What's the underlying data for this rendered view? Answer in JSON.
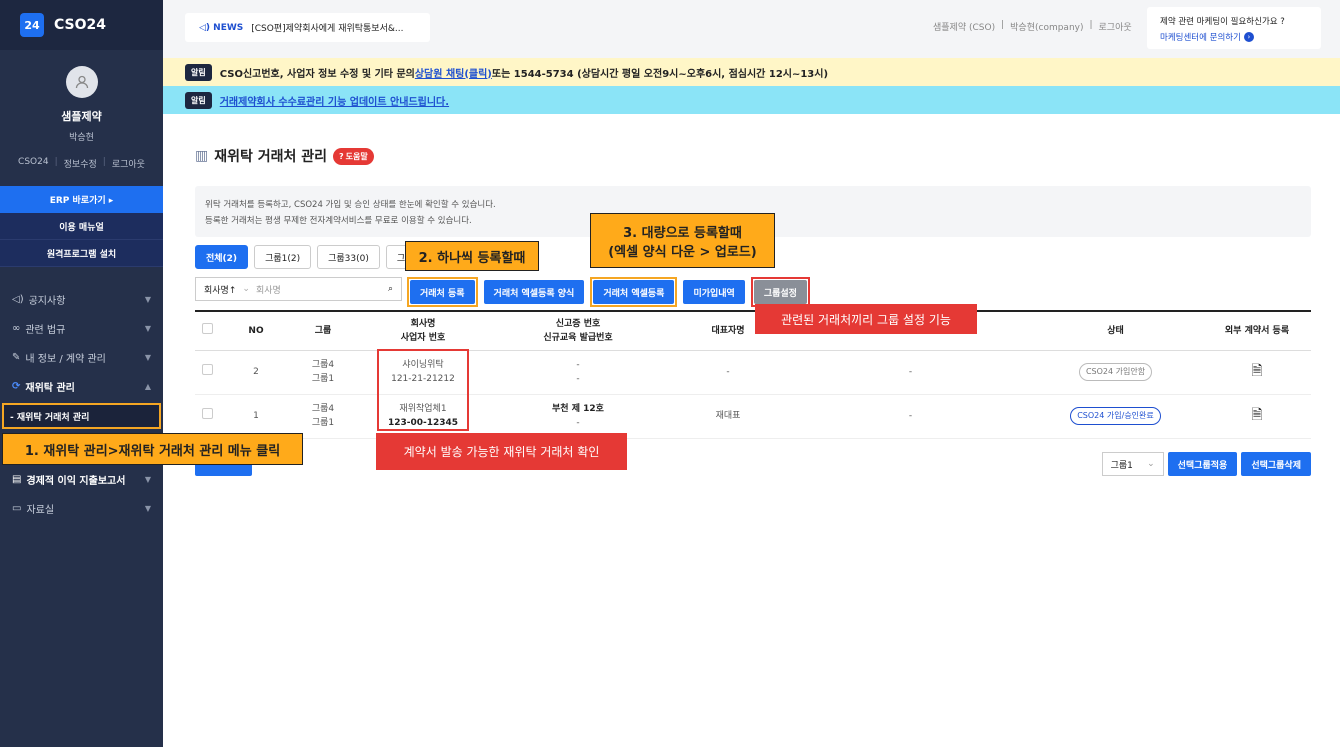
{
  "app": {
    "badge": "24",
    "name": "CSO24"
  },
  "profile": {
    "company": "샘플제약",
    "user": "박승현",
    "links": [
      "CSO24",
      "정보수정",
      "로그아웃"
    ]
  },
  "sidebar": {
    "erp": "ERP 바로가기 ▸",
    "manual": "이용 매뉴얼",
    "remote": "원격프로그램 설치",
    "items": [
      {
        "label": "공지사항",
        "icon": "speaker-icon"
      },
      {
        "label": "관련 법규",
        "icon": "link-icon"
      },
      {
        "label": "내 정보 / 계약 관리",
        "icon": "pen-icon"
      },
      {
        "label": "재위탁 관리",
        "icon": "refresh-icon"
      },
      {
        "label": "경제적 이익 지출보고서",
        "icon": "document-icon"
      },
      {
        "label": "자료실",
        "icon": "archive-icon"
      }
    ],
    "sub_item": "- 재위탁 거래처 관리"
  },
  "topbar": {
    "news_tag": "NEWS",
    "news_text": "[CSO편]제약회사에게 재위탁통보서&...",
    "links": [
      "샘플제약 (CSO)",
      "박승현(company)",
      "로그아웃"
    ],
    "ad_line1": "제약 관련 마케팅이 필요하신가요 ?",
    "ad_line2": "마케팅센터에 문의하기"
  },
  "notices": {
    "tag": "알림",
    "n1_pre": "CSO신고번호, 사업자 정보 수정 및 기타 문의 ",
    "n1_link": "상담원 채팅(클릭)",
    "n1_post": " 또는 1544-5734 (상담시간 평일 오전9시~오후6시, 점심시간 12시~13시)",
    "n2": "거래제약회사 수수료관리 기능 업데이트 안내드립니다."
  },
  "page": {
    "title": "재위탁 거래처 관리",
    "help": "도움말",
    "desc1": "위탁 거래처를 등록하고, CSO24 가입 및 승인 상태를 한눈에 확인할 수 있습니다.",
    "desc2": "등록한 거래처는 평생 무제한 전자계약서비스를 무료로 이용할 수 있습니다."
  },
  "tabs": [
    "전체(2)",
    "그룹1(2)",
    "그룹33(0)",
    "그"
  ],
  "search": {
    "field": "회사명↑",
    "placeholder": "회사명"
  },
  "buttons": {
    "register": "거래처 등록",
    "excel_form": "거래처 엑셀등록 양식",
    "excel_register": "거래처 엑셀등록",
    "unjoined": "미가입내역",
    "group_setting": "그룹설정"
  },
  "table": {
    "headers": [
      "NO",
      "그룹",
      "회사명",
      "사업자 번호",
      "신고증 번호",
      "신규교육 발급번호",
      "대표자명",
      "상태",
      "외부 계약서 등록"
    ],
    "rows": [
      {
        "no": "2",
        "group1": "그룹4",
        "group2": "그룹1",
        "name": "샤이닝위탁",
        "bizno": "121-21-21212",
        "cert": "-",
        "edu": "-",
        "rep": "-",
        "extra": "-",
        "status": "CSO24 가입안함"
      },
      {
        "no": "1",
        "group1": "그룹4",
        "group2": "그룹1",
        "name": "재위착업체1",
        "bizno": "123-00-12345",
        "cert": "부천 제 12호",
        "edu": "-",
        "rep": "재대표",
        "extra": "-",
        "status": "CSO24 가입/승인완료"
      }
    ]
  },
  "bottom": {
    "group_select": "그룹1",
    "apply": "선택그룹적용",
    "delete": "선택그룹삭제"
  },
  "annotations": {
    "a1": "1. 재위탁 관리>재위탁 거래처 관리 메뉴 클릭",
    "a2": "2. 하나씩 등록할때",
    "a3_l1": "3. 대량으로 등록할때",
    "a3_l2": "(엑셀 양식 다운 > 업로드)",
    "a4": "관련된 거래처끼리 그룹 설정 기능",
    "a5": "계약서 발송 가능한 재위탁 거래처 확인"
  }
}
